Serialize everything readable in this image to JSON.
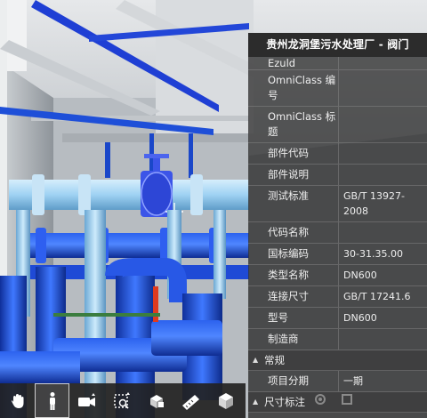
{
  "viewport": {
    "scene": "3d-model-viewport"
  },
  "panel": {
    "title": "贵州龙洞堡污水处理厂 - 阀门",
    "top_cut_label": "Ezuld",
    "rows": [
      {
        "key": "OmniClass 编号",
        "value": ""
      },
      {
        "key": "OmniClass 标题",
        "value": ""
      },
      {
        "key": "部件代码",
        "value": ""
      },
      {
        "key": "部件说明",
        "value": ""
      },
      {
        "key": "测试标准",
        "value": "GB/T 13927-2008"
      },
      {
        "key": "代码名称",
        "value": ""
      },
      {
        "key": "国标编码",
        "value": "30-31.35.00"
      },
      {
        "key": "类型名称",
        "value": "DN600"
      },
      {
        "key": "连接尺寸",
        "value": "GB/T 17241.6"
      },
      {
        "key": "型号",
        "value": "DN600"
      },
      {
        "key": "制造商",
        "value": ""
      }
    ],
    "group1": "常规",
    "group1_rows": [
      {
        "key": "项目分期",
        "value": "一期"
      }
    ],
    "group2": "尺寸标注"
  },
  "toolbar": {
    "tools": [
      {
        "name": "pan-hand-icon"
      },
      {
        "name": "person-walk-icon"
      },
      {
        "name": "camera-icon"
      },
      {
        "name": "section-box-icon"
      },
      {
        "name": "model-tree-icon"
      },
      {
        "name": "measure-ruler-icon"
      },
      {
        "name": "cube-view-icon"
      }
    ],
    "active_tool": "person-walk-icon"
  },
  "colors": {
    "pipe_blue": "#1e4fd8",
    "pipe_light": "#a8d8f5",
    "panel_bg": "#343434",
    "accent_red": "#e03a1e"
  }
}
